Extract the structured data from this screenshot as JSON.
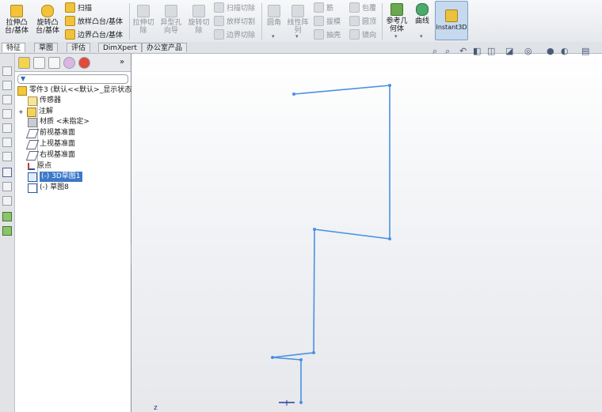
{
  "ribbon": {
    "extrude_boss": "拉伸凸\n台/基体",
    "revolve_boss": "旋转凸\n台/基体",
    "sweep": "扫描",
    "loft_boss": "放样凸台/基体",
    "boundary_boss": "边界凸台/基体",
    "extrude_cut": "拉伸切\n除",
    "hole_wizard": "异型孔\n向导",
    "revolve_cut": "旋转切\n除",
    "swept_cut": "扫描切除",
    "lofted_cut": "放样切割",
    "boundary_cut": "边界切除",
    "fillet": "圆角",
    "linear_pattern": "线性阵\n列",
    "rib": "筋",
    "draft": "拔模",
    "shell": "抽壳",
    "wrap": "包覆",
    "dome": "圆顶",
    "mirror": "镜向",
    "reference_geometry": "参考几\n何体",
    "curves": "曲线",
    "instant3d": "Instant3D"
  },
  "tabs": [
    "特征",
    "草图",
    "评估",
    "DimXpert",
    "办公室产品"
  ],
  "tree": {
    "root": "零件3 (默认<<默认>_显示状态",
    "items": [
      "传感器",
      "注解",
      "材质 <未指定>",
      "前视基准面",
      "上视基准面",
      "右视基准面",
      "原点",
      "(-) 3D草图1",
      "(-) 草图8"
    ],
    "expand_marker": "+"
  },
  "panel_tabs_overflow": "»",
  "viewport": {
    "axis_label": "z",
    "sketch_color": "#4a90e2"
  },
  "colors": {
    "accent": "#3d79c8",
    "selection": "#3d79c8"
  }
}
